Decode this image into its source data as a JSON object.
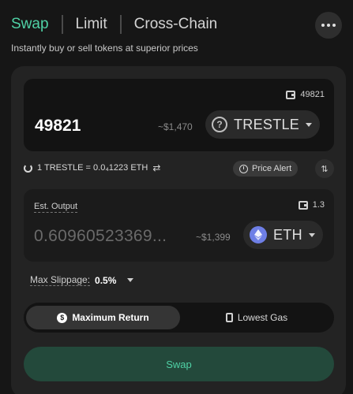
{
  "header": {
    "tabs": [
      {
        "label": "Swap",
        "active": true
      },
      {
        "label": "Limit",
        "active": false
      },
      {
        "label": "Cross-Chain",
        "active": false
      }
    ],
    "subtitle": "Instantly buy or sell tokens at superior prices",
    "more_icon": "more-horizontal-icon"
  },
  "input": {
    "balance": "49821",
    "amount": "49821",
    "usd_value": "~$1,470",
    "token": "TRESTLE",
    "token_icon": "question-circle-icon"
  },
  "rate": {
    "text": "1 TRESTLE = 0.0₄1223 ETH",
    "price_alert_label": "Price Alert"
  },
  "output": {
    "label": "Est. Output",
    "balance": "1.3",
    "amount": "0.60960523369...",
    "usd_value": "~$1,399",
    "token": "ETH",
    "token_icon": "ethereum-icon"
  },
  "slippage": {
    "label": "Max Slippage:",
    "value": "0.5%"
  },
  "route_mode": {
    "options": [
      {
        "label": "Maximum Return",
        "icon": "dollar-circle-icon",
        "active": true
      },
      {
        "label": "Lowest Gas",
        "icon": "gas-pump-icon",
        "active": false
      }
    ]
  },
  "swap_button_label": "Swap",
  "colors": {
    "accent": "#4fd1a5",
    "background": "#161616",
    "card": "#232323",
    "swap_button": "#23493b"
  }
}
